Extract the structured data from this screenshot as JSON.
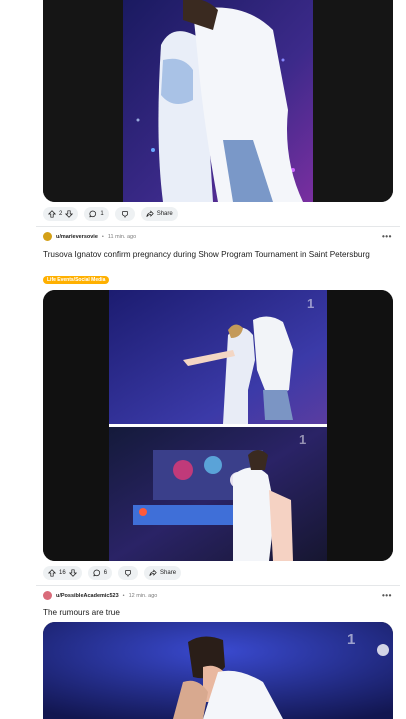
{
  "post1": {
    "upvotes": "2",
    "comments": "1",
    "share_label": "Share"
  },
  "post2": {
    "username": "u/marieversovie",
    "time": "11 min. ago",
    "title": "Trusova Ignatov confirm pregnancy during Show Program Tournament in Saint Petersburg",
    "flair": "Life Events/Social Media",
    "watermark": "1",
    "upvotes": "16",
    "comments": "6",
    "share_label": "Share"
  },
  "post3": {
    "username": "u/PossibleAcademic523",
    "time": "12 min. ago",
    "title": "The rumours are true",
    "watermark": "1"
  },
  "separator": "•",
  "more_label": "•••",
  "colors": {
    "flair": "#ffb000",
    "pill_bg": "#eef1f3",
    "avatar1": "#d4a017",
    "avatar2": "#d96b7a"
  }
}
